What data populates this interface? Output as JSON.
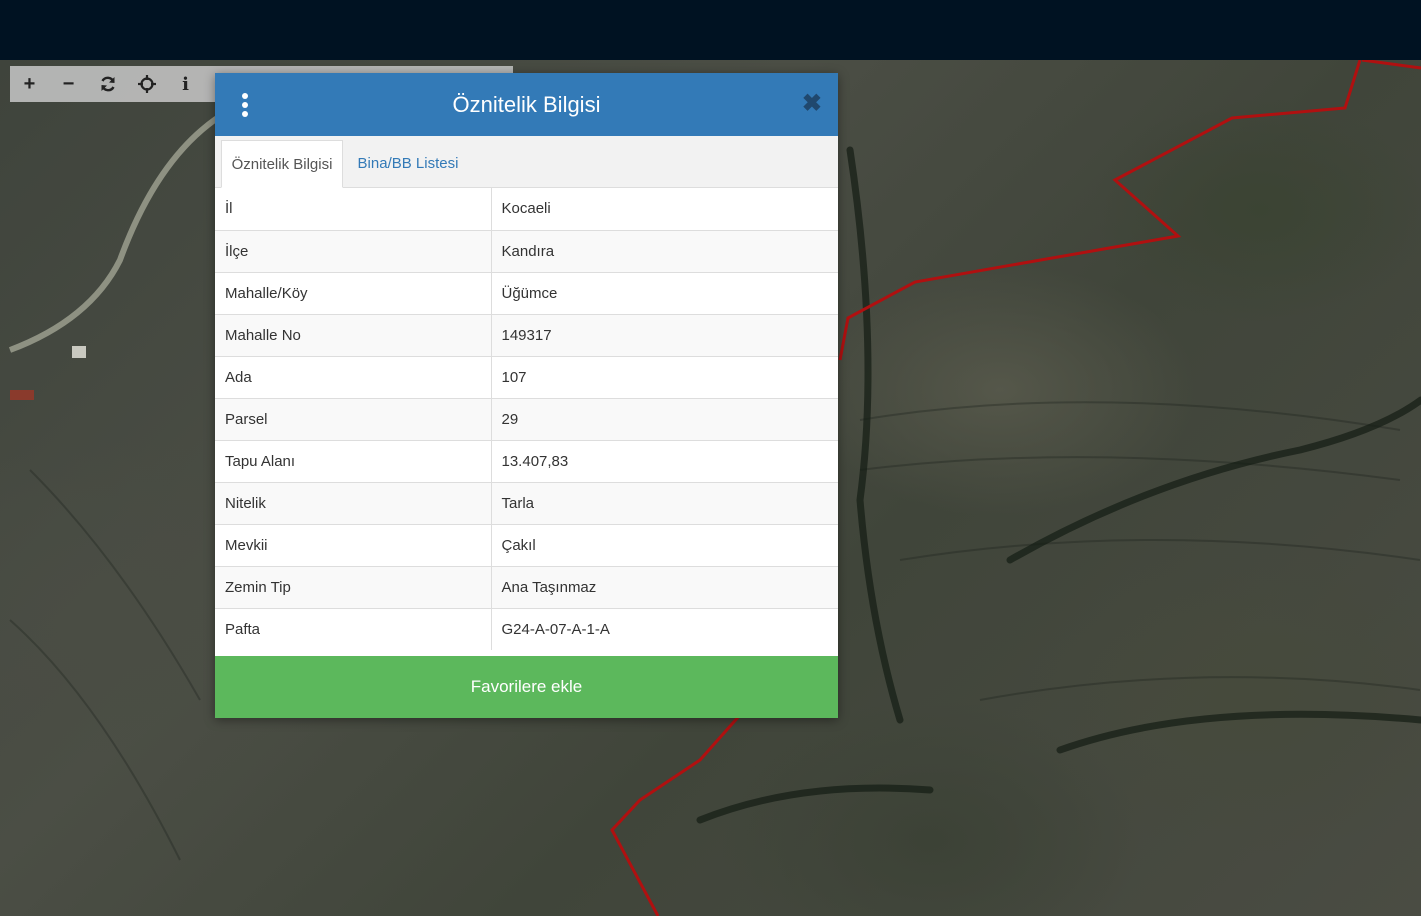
{
  "toolbar": {
    "buttons": [
      {
        "name": "zoom-in-button",
        "icon": "plus-icon",
        "glyph": "+"
      },
      {
        "name": "zoom-out-button",
        "icon": "minus-icon",
        "glyph": "−"
      },
      {
        "name": "refresh-button",
        "icon": "refresh-icon"
      },
      {
        "name": "locate-button",
        "icon": "crosshair-icon"
      },
      {
        "name": "info-button",
        "icon": "info-icon",
        "glyph": "i"
      }
    ]
  },
  "dialog": {
    "title": "Öznitelik Bilgisi",
    "close_glyph": "✖",
    "tabs": [
      {
        "label": "Öznitelik Bilgisi",
        "active": true
      },
      {
        "label": "Bina/BB Listesi",
        "active": false
      }
    ],
    "rows": [
      {
        "key": "İl",
        "value": "Kocaeli"
      },
      {
        "key": "İlçe",
        "value": "Kandıra"
      },
      {
        "key": "Mahalle/Köy",
        "value": "Üğümce"
      },
      {
        "key": "Mahalle No",
        "value": "149317"
      },
      {
        "key": "Ada",
        "value": "107"
      },
      {
        "key": "Parsel",
        "value": "29"
      },
      {
        "key": "Tapu Alanı",
        "value": "13.407,83"
      },
      {
        "key": "Nitelik",
        "value": "Tarla"
      },
      {
        "key": "Mevkii",
        "value": "Çakıl"
      },
      {
        "key": "Zemin Tip",
        "value": "Ana Taşınmaz"
      },
      {
        "key": "Pafta",
        "value": "G24-A-07-A-1-A"
      }
    ],
    "favorite_label": "Favorilere ekle"
  },
  "colors": {
    "header": "#337ab7",
    "favorite": "#5cb85c",
    "boundary": "#b01010",
    "topbar": "#001222"
  }
}
